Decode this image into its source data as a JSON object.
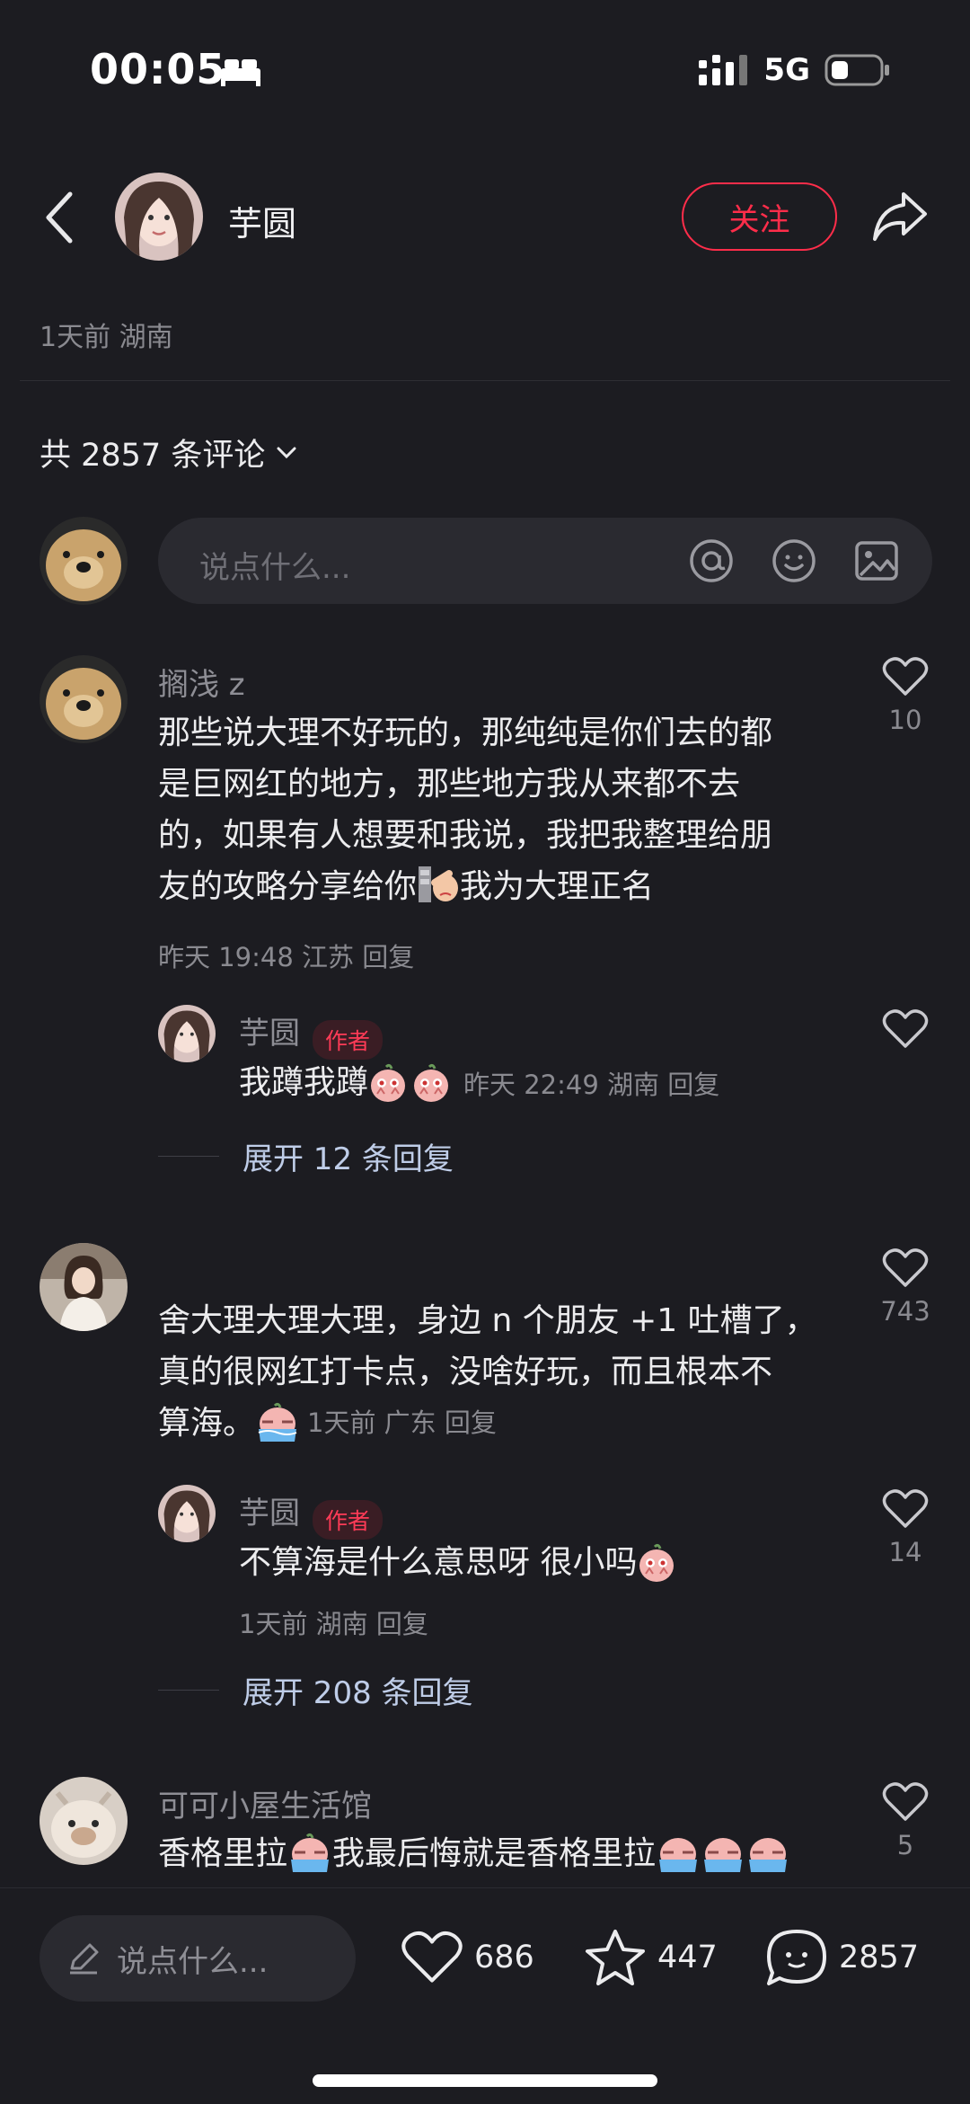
{
  "status_bar": {
    "time": "00:05",
    "network": "5G"
  },
  "header": {
    "author_name": "芋圆",
    "follow_label": "关注"
  },
  "post_meta": "1天前 湖南",
  "comments_count_label": "共 2857 条评论",
  "input": {
    "placeholder": "说点什么..."
  },
  "comments": [
    {
      "user": "搁浅 z",
      "text": "那些说大理不好玩的，那纯纯是你们去的都是巨网红的地方，那些地方我从来都不去的，如果有人想要和我说，我把我整理给朋友的攻略分享给你",
      "text_line1": "那些说大理不好玩的，那纯纯是你们去的都",
      "text_line2": "是巨网红的地方，那些地方我从来都不去",
      "text_line3": "的，如果有人想要和我说，我把我整理给朋",
      "text_line4a": "友的攻略分享给你",
      "text_line4b": "我为大理正名",
      "meta": "昨天 19:48 江苏 回复",
      "likes": "10",
      "reply": {
        "user": "芋圆",
        "badge": "作者",
        "text": "我蹲我蹲",
        "meta": "昨天 22:49 湖南 回复",
        "likes": ""
      },
      "expand_label": "展开 12 条回复"
    },
    {
      "user": "",
      "text_line1": "舍大理大理大理，身边 n 个朋友 +1 吐槽了，",
      "text_line2": "真的很网红打卡点，没啥好玩，而且根本不",
      "text_line3": "算海。",
      "meta": "1天前 广东 回复",
      "likes": "743",
      "reply": {
        "user": "芋圆",
        "badge": "作者",
        "text": "不算海是什么意思呀 很小吗",
        "meta": "1天前 湖南 回复",
        "likes": "14"
      },
      "expand_label": "展开 208 条回复"
    },
    {
      "user": "可可小屋生活馆",
      "text_a": "香格里拉",
      "text_b": "我最后悔就是香格里拉",
      "likes": "5"
    }
  ],
  "bottom_bar": {
    "placeholder": "说点什么...",
    "likes": "686",
    "favorites": "447",
    "comments": "2857"
  }
}
